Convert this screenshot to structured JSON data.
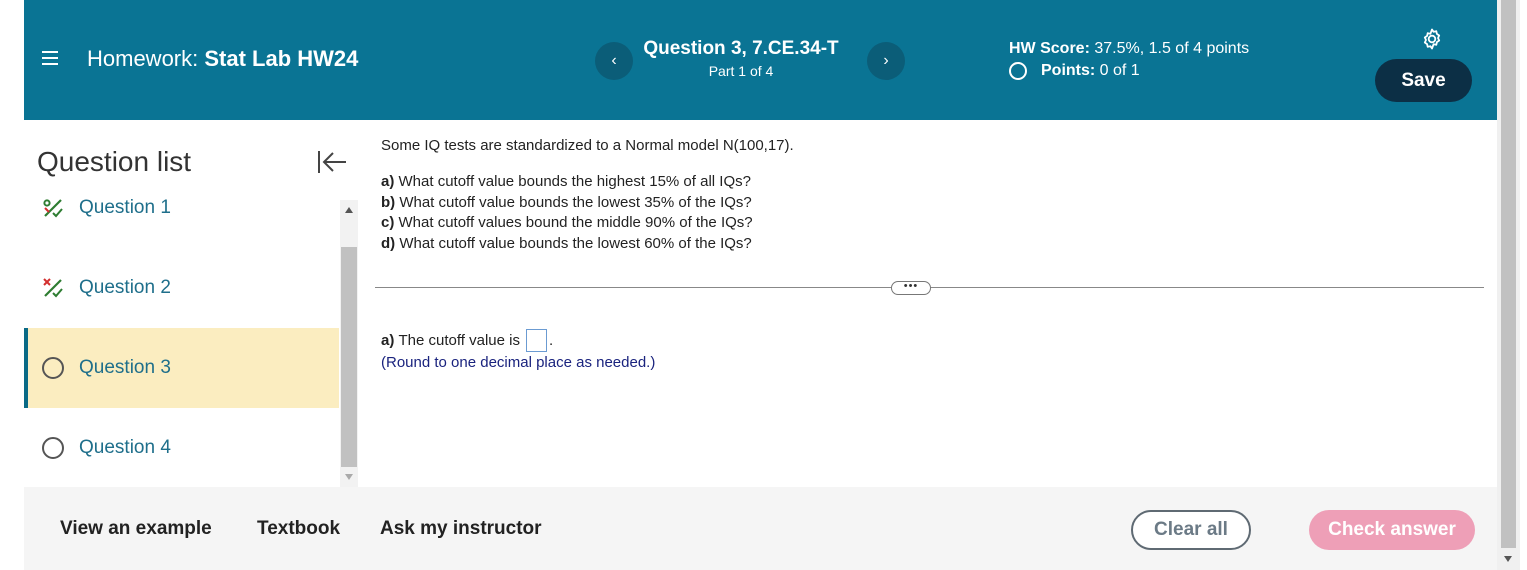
{
  "header": {
    "homework_label": "Homework:",
    "homework_name": "Stat Lab HW24",
    "question_title": "Question 3, 7.CE.34-T",
    "question_part": "Part 1 of 4",
    "prev_label": "‹",
    "next_label": "›",
    "hw_score_label": "HW Score:",
    "hw_score_value": "37.5%, 1.5 of 4 points",
    "points_label": "Points:",
    "points_value": "0 of 1",
    "save_label": "Save",
    "colors": {
      "bar": "#0a7494",
      "save": "#0c2f45"
    }
  },
  "sidebar": {
    "title": "Question list",
    "items": [
      {
        "label": "Question 1",
        "status": "partial-icon"
      },
      {
        "label": "Question 2",
        "status": "partial-icon"
      },
      {
        "label": "Question 3",
        "status": "current-circle-icon",
        "active": true
      },
      {
        "label": "Question 4",
        "status": "circle-icon"
      }
    ]
  },
  "question": {
    "intro": "Some IQ tests are standardized to a Normal model N(100,17).",
    "parts": [
      {
        "letter": "a)",
        "text": "What cutoff value bounds the highest 15% of all IQs?"
      },
      {
        "letter": "b)",
        "text": "What cutoff value bounds the lowest 35% of the IQs?"
      },
      {
        "letter": "c)",
        "text": "What cutoff values bound the middle 90% of the IQs?"
      },
      {
        "letter": "d)",
        "text": "What cutoff value bounds the lowest 60% of the IQs?"
      }
    ],
    "ellipsis": "•••",
    "answer_letter": "a)",
    "answer_text": "The cutoff value is",
    "answer_value": "",
    "answer_end": ".",
    "round_note": "(Round to one decimal place as needed.)"
  },
  "footer": {
    "view_example": "View an example",
    "textbook": "Textbook",
    "ask_instructor": "Ask my instructor",
    "clear_all": "Clear all",
    "check_answer": "Check answer"
  }
}
